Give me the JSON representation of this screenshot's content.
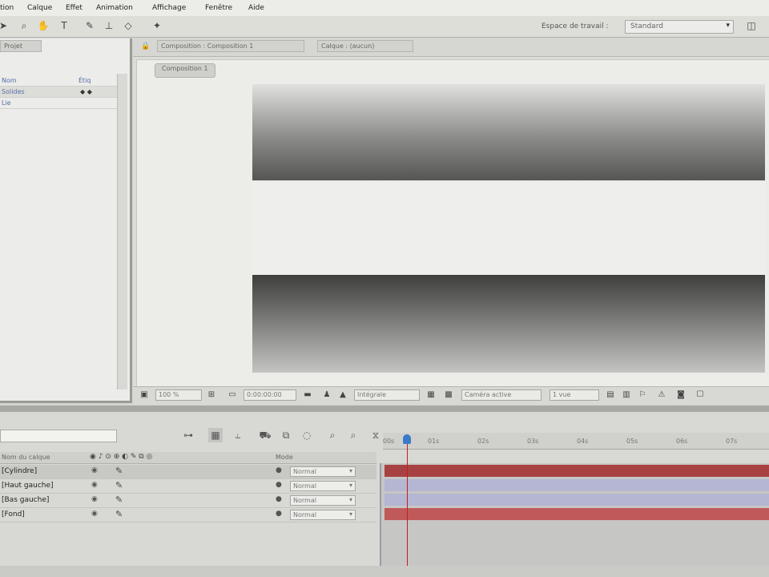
{
  "menubar": {
    "items": [
      "tion",
      "Calque",
      "Effet",
      "Animation",
      "Affichage",
      "Fenêtre",
      "Aide"
    ]
  },
  "toolbar": {
    "tools": [
      "arrow-icon",
      "zoom-icon",
      "hand-icon",
      "text-icon",
      "brush-icon",
      "stamp-icon",
      "eraser-icon",
      "puppet-icon"
    ],
    "workspace_label": "Espace de travail :",
    "workspace_value": "Standard",
    "workspace_dropdown_icon": "▾"
  },
  "project": {
    "tab_label": "Projet",
    "rows": [
      {
        "name": "Nom",
        "extra": "Étiq"
      },
      {
        "name": "Solides",
        "extra": "◆ ◆"
      },
      {
        "name": "Lie",
        "extra": ""
      }
    ]
  },
  "composition": {
    "tab_label": "Composition : Composition 1",
    "tab2_label": "Calque : (aucun)",
    "subtab_label": "Composition 1",
    "footer": {
      "zoom": "100 %",
      "timecode": "0:00:00:00",
      "quality": "Intégrale",
      "camera": "Caméra active",
      "views": "1 vue"
    }
  },
  "timeline": {
    "search_placeholder": "",
    "header_source": "Nom du calque",
    "header_mode": "Mode",
    "ruler_ticks": [
      "00s",
      "01s",
      "02s",
      "03s",
      "04s",
      "05s",
      "06s",
      "07s"
    ],
    "layers": [
      {
        "name": "[Cylindre]",
        "mode": "Normal"
      },
      {
        "name": "[Haut gauche]",
        "mode": "Normal"
      },
      {
        "name": "[Bas gauche]",
        "mode": "Normal"
      },
      {
        "name": "[Fond]",
        "mode": "Normal"
      }
    ]
  },
  "colors": {
    "bar_red": "#b04848",
    "bar_lavender": "#b4b6d2",
    "playhead": "#c02020",
    "playhead_knob": "#3a7bc8"
  }
}
